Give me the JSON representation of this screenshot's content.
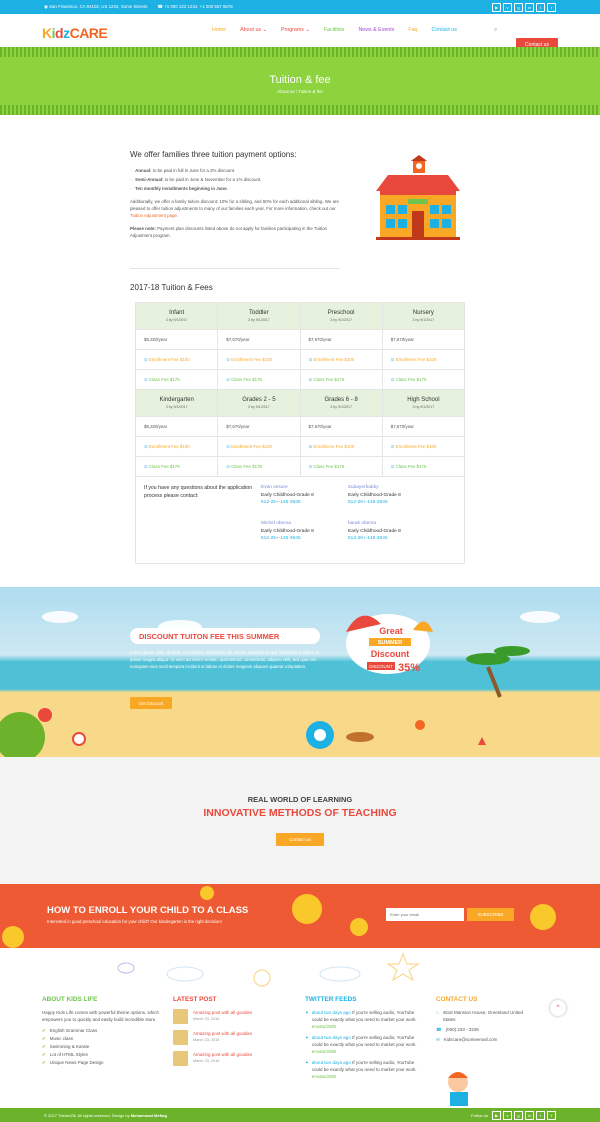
{
  "topbar": {
    "address": "San Francisco, CA 94102, US 1234, Some Streets",
    "phones": "+1 000 123 1234, +1 000 567 5678",
    "social_icons": [
      "youtube-icon",
      "vimeo-icon",
      "google-plus-icon",
      "linkedin-icon",
      "twitter-icon",
      "facebook-icon"
    ]
  },
  "header": {
    "logo": {
      "k": "K",
      "i": "i",
      "d": "d",
      "z": "z",
      "c": "CARE"
    },
    "nav": [
      {
        "label": "Home",
        "color": "#f9a826"
      },
      {
        "label": "About us ⌄",
        "color": "#e9493c"
      },
      {
        "label": "Programs ⌄",
        "color": "#e9493c"
      },
      {
        "label": "Facilities",
        "color": "#6ec44c"
      },
      {
        "label": "News & Events",
        "color": "#a24ad6"
      },
      {
        "label": "Faq",
        "color": "#f9a826"
      },
      {
        "label": "Contact us",
        "color": "#1cb0e3"
      }
    ],
    "search_icon": "search-icon",
    "contact_button": "Contact us"
  },
  "hero": {
    "title": "Tuition & fee",
    "breadcrumb": "About us / Tuition & fee"
  },
  "intro": {
    "heading": "We offer families three tuition payment options:",
    "options": [
      {
        "bold": "Annual:",
        "text": " to be paid in full in June for a 2% discount."
      },
      {
        "bold": "Semi-Annual:",
        "text": " to be paid in June & November for a 1% discount."
      },
      {
        "bold": "Ten monthly installments beginning in June.",
        "text": ""
      }
    ],
    "para1": "Additionally, we offer a family tuition discount: 10% for a sibling, and 50% for each additional sibling. We are pleased to offer tuition adjustments to many of our families each year. For more information, check out our",
    "para1_link": "Tuition Adjustment page.",
    "note_bold": "Please note:",
    "note_text": " Payment plan discounts listed above do not apply for families participating in the Tuition Adjustment program."
  },
  "fees": {
    "heading": "2017-18 Tuition & Fees",
    "tables": [
      {
        "headers": [
          {
            "name": "Infant",
            "date": "3 by 9/1/2017"
          },
          {
            "name": "Toddler",
            "date": "3 by 9/1/2017"
          },
          {
            "name": "Preschool",
            "date": "3 by 9/1/2017"
          },
          {
            "name": "Nursery",
            "date": "3 by 9/1/2017"
          }
        ],
        "prices": [
          "$5,320/year",
          "$7,670/year",
          "$7,670/year",
          "$7,670/year"
        ],
        "enrollment": [
          "Enrollment Fee $100",
          "Enrollment Fee $100",
          "Enrollment Fee $100",
          "Enrollment Fee $100"
        ],
        "class": [
          "Class Fee $175",
          "Class Fee $175",
          "Class Fee $175",
          "Class Fee $175"
        ]
      },
      {
        "headers": [
          {
            "name": "Kindergarten",
            "date": "3 by 9/1/2017"
          },
          {
            "name": "Grades 2 - 5",
            "date": "3 by 9/1/2017"
          },
          {
            "name": "Grades 6 - 8",
            "date": "3 by 9/1/2017"
          },
          {
            "name": "High School",
            "date": "3 by 9/1/2017"
          }
        ],
        "prices": [
          "$5,320/year",
          "$7,670/year",
          "$7,670/year",
          "$7,670/year"
        ],
        "enrollment": [
          "Enrollment Fee $100",
          "Enrollment Fee $100",
          "Enrollment Fee $100",
          "Enrollment Fee $100"
        ],
        "class": [
          "Class Fee $175",
          "Class Fee $175",
          "Class Fee $175",
          "Class Fee $175"
        ]
      }
    ],
    "question": "If you have any questions about the application process please contact:",
    "contacts": [
      {
        "name": "Even ossure",
        "role": "Early Childhood-Grade 8",
        "phone": "512-25+-145-3645"
      },
      {
        "name": "Zubayerbabby",
        "role": "Early Childhood-Grade 8",
        "phone": "512-25+-145-3645"
      },
      {
        "name": "Michel obema",
        "role": "Early Childhood-Grade 8",
        "phone": "512-25+-145-3645"
      },
      {
        "name": "barak obema",
        "role": "Early Childhood-Grade 8",
        "phone": "512-25+-145-3645"
      }
    ]
  },
  "summer": {
    "title": "DISCOUNT TUITON FEE THIS SUMMER",
    "text": "Lorem ipsum dolor sit amet, consectetur adipisicing elit, sed do eiusmod tempor incididunt ut labore et dolore magna aliqua. Ut enim ad minim veniam, quisnostrud. consectetur, adipisci velit, sed quia non numquam eius modi tempora incidunt ut labore et dolore magnam aliquam quaerat voluptatem.",
    "button": "Get Discount",
    "badge": {
      "great": "Great",
      "summer": "SUMMER",
      "discount": "Discount",
      "discount_label": "DISCOUNT",
      "percent": "35%"
    }
  },
  "methods": {
    "subtitle": "REAL WORLD OF LEARNING",
    "title": "INNOVATIVE METHODS OF TEACHING",
    "button": "Contact us"
  },
  "enroll": {
    "title": "HOW TO ENROLL YOUR CHILD TO A CLASS",
    "text": "Interested in good preschool education for your child? Our kindergarten is the right decision!",
    "placeholder": "Enter your email",
    "button": "SUBSCRIBE"
  },
  "footer": {
    "about": {
      "title": "ABOUT KIDS LIFE",
      "text": "Happy Kids Life comes with powerful theme options, which empowers you to quickly and easily build incredible store.",
      "items": [
        "English Grammar Class",
        "Music class",
        "Swimming & Karate",
        "Lot of HTML Styles",
        "Unique News Page Design"
      ]
    },
    "posts": {
      "title": "LATEST POST",
      "items": [
        {
          "title": "Amazing post with all goodies",
          "date": "March 23, 2016"
        },
        {
          "title": "Amazing post with all goodies",
          "date": "March 23, 2016"
        },
        {
          "title": "Amazing post with all goodies",
          "date": "March 23, 2016"
        }
      ]
    },
    "twitter": {
      "title": "TWITTER FEEDS",
      "items": [
        {
          "link": "about two days ago",
          "text": " If you're selling audio, YouTube could be exactly what you need to market your work.",
          "short": "envato/2i0l5"
        },
        {
          "link": "about two days ago",
          "text": " If you're selling audio, YouTube could be exactly what you need to market your work.",
          "short": "envato/2i0l5"
        },
        {
          "link": "about two days ago",
          "text": " If you're selling audio, YouTube could be exactly what you need to market your work.",
          "short": "envato/2i0l5"
        }
      ]
    },
    "contact": {
      "title": "CONTACT US",
      "address": "4518 Mansion House, Greenland United States",
      "phone": "(000) 233 - 3236",
      "email": "Kidscare@someemail.com"
    }
  },
  "bottombar": {
    "copyright": "© 2017 ThemeZill. All rights reserved. Design by",
    "designer": "Mohammad Meftag",
    "follow": "Follow us"
  },
  "colors": {
    "blue": "#1cb0e3",
    "green": "#8cd33e",
    "orange": "#f9a826",
    "red": "#e9493c"
  }
}
